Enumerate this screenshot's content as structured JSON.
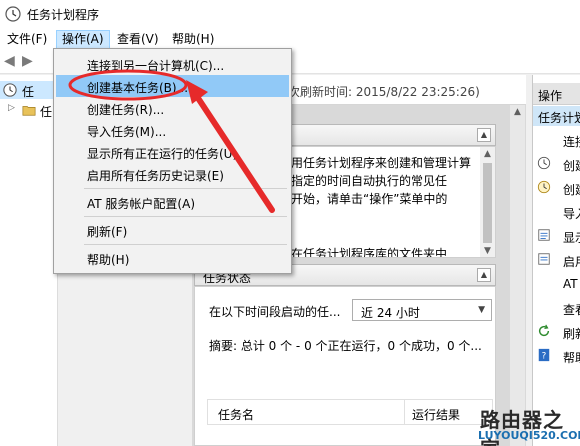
{
  "window": {
    "title": "任务计划程序"
  },
  "menubar": {
    "items": [
      "文件(F)",
      "操作(A)",
      "查看(V)",
      "帮助(H)"
    ]
  },
  "tree": {
    "root_label": "任",
    "child_label": "任"
  },
  "center": {
    "header_text": "次刷新时间: 2015/8/22 23:25:26)",
    "overview": {
      "lines": [
        "用任务计划程序来创建和管理计算",
        "指定的时间自动执行的常见任",
        "开始，请单击“操作”菜单中的"
      ],
      "partial_line": "在任务计划程序库的文件夹中"
    },
    "status_section": {
      "title": "任务状态",
      "filter_label": "在以下时间段启动的任...",
      "filter_value": "近 24 小时",
      "summary": "摘要: 总计 0 个 - 0 个正在运行，0 个成功，0 个...",
      "columns": [
        "任务名",
        "运行结果"
      ]
    }
  },
  "actions_pane": {
    "header": "操作",
    "subheader": "任务计划",
    "items": [
      "连接",
      "创建",
      "创建",
      "导入",
      "显示",
      "启用",
      "AT",
      "查看",
      "刷新",
      "帮助"
    ]
  },
  "dropdown": {
    "items": [
      "连接到另一台计算机(C)...",
      "创建基本任务(B)...",
      "创建任务(R)...",
      "导入任务(M)...",
      "显示所有正在运行的任务(U)",
      "启用所有任务历史记录(E)",
      "AT 服务帐户配置(A)",
      "刷新(F)",
      "帮助(H)"
    ],
    "highlighted_index": 1
  },
  "annotation": {
    "color": "#e62a2a"
  },
  "watermark": {
    "line1": "路由器之家",
    "line2": "LUYOUQI520.COM"
  }
}
